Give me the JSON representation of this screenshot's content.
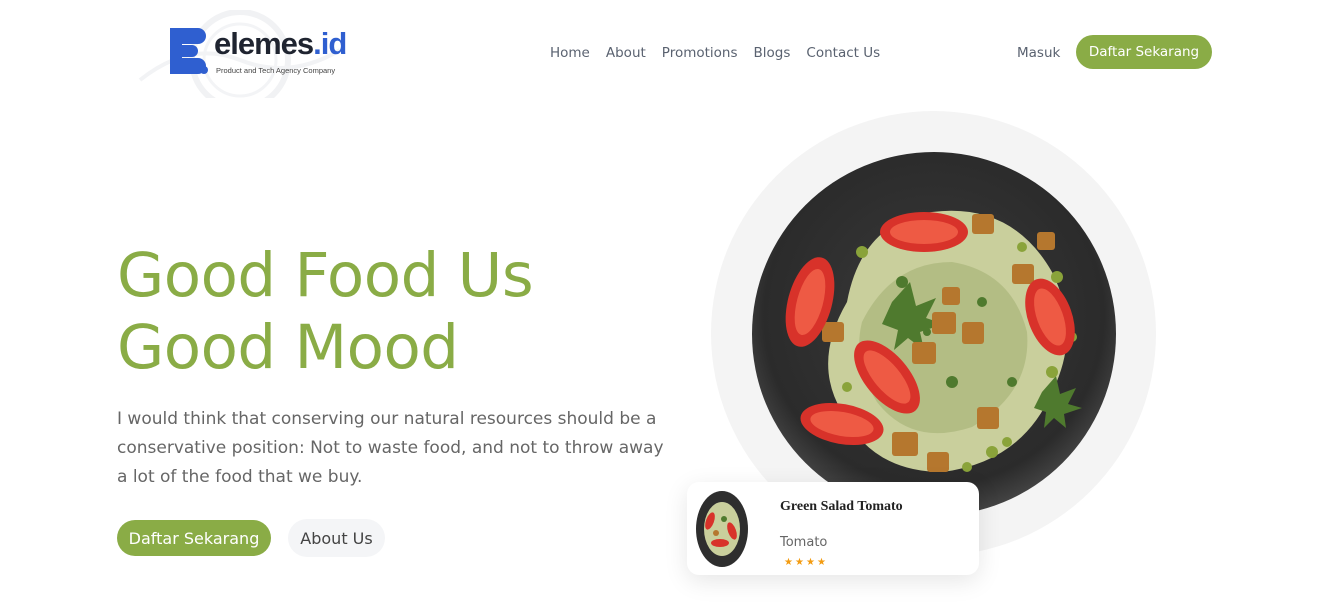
{
  "brand": {
    "name": "elemes",
    "name_suffix": ".id",
    "tagline": "Product and Tech Agency Company",
    "accent_color": "#8aac46",
    "logo_blue": "#2f5fd0"
  },
  "nav": {
    "items": [
      "Home",
      "About",
      "Promotions",
      "Blogs",
      "Contact Us"
    ]
  },
  "auth": {
    "login_label": "Masuk",
    "signup_label": "Daftar Sekarang"
  },
  "hero": {
    "headline_line1": "Good Food Us",
    "headline_line2": "Good Mood",
    "lead": "I would think that conserving our natural resources should be a conservative position: Not to waste food, and not to throw away a lot of the food that we buy.",
    "primary_cta": "Daftar Sekarang",
    "secondary_cta": "About Us",
    "image_icon": "salad-plate-image"
  },
  "product_card": {
    "title": "Green Salad Tomato",
    "subtitle": "Tomato",
    "rating": 4,
    "rating_max": 4,
    "star_color": "#f39c12"
  }
}
